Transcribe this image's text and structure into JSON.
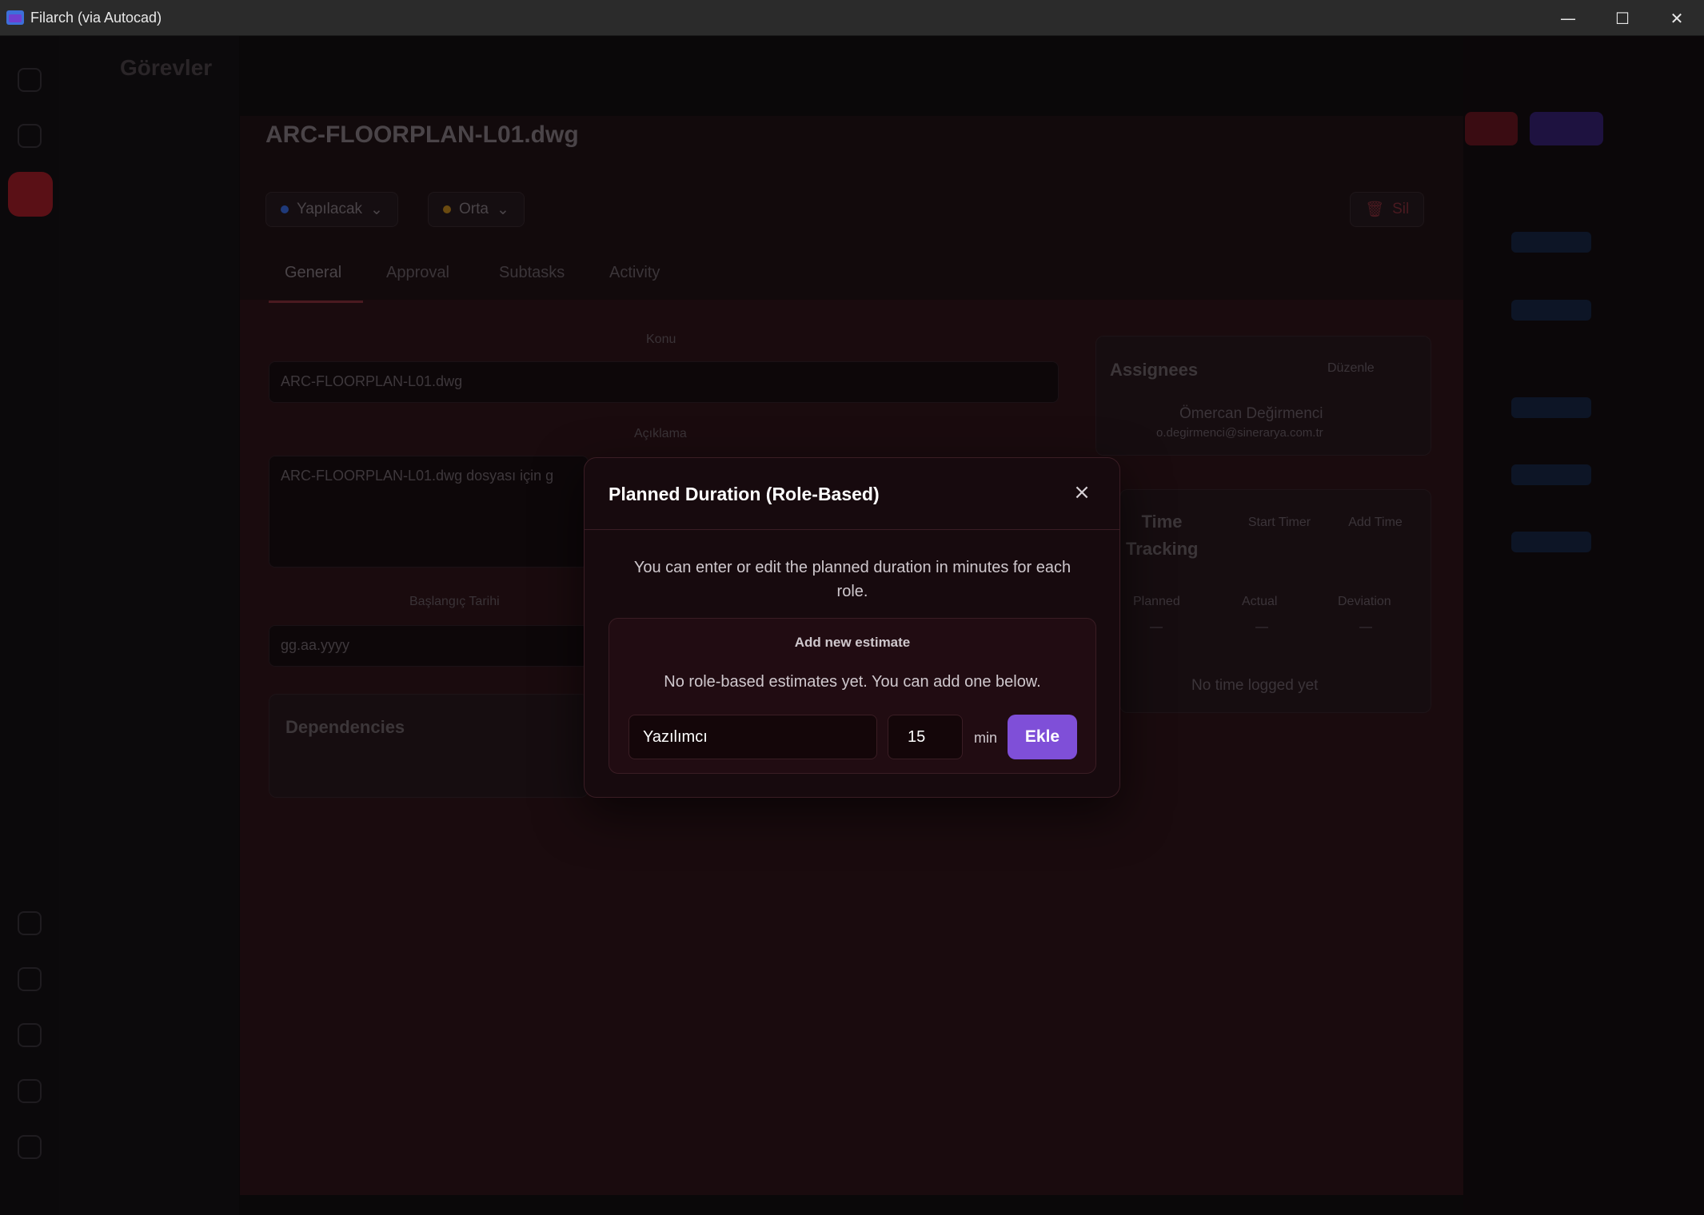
{
  "window": {
    "title": "Filarch (via Autocad)",
    "minimize": "—",
    "maximize": "☐",
    "close": "✕"
  },
  "background": {
    "header_title": "Görevler",
    "doc_title": "ARC-FLOORPLAN-L01.dwg",
    "status_pill": "Yapılacak",
    "priority_pill": "Orta",
    "delete_label": "Sil",
    "tabs": [
      "General",
      "Approval",
      "Subtasks",
      "Activity"
    ],
    "subject_label": "Konu",
    "subject_value": "ARC-FLOORPLAN-L01.dwg",
    "description_label": "Açıklama",
    "description_value": "ARC-FLOORPLAN-L01.dwg dosyası için g",
    "start_date_label": "Başlangıç Tarihi",
    "start_date_value": "gg.aa.yyyy",
    "dependencies_title": "Dependencies",
    "assignees_title": "Assignees",
    "assignees_edit": "Düzenle",
    "assignee_name": "Ömercan Değirmenci",
    "assignee_email": "o.degirmenci@sinerarya.com.tr",
    "time_tracking_title": "Time Tracking",
    "start_timer": "Start Timer",
    "add_time": "Add Time",
    "planned_label": "Planned",
    "actual_label": "Actual",
    "deviation_label": "Deviation",
    "planned_value": "—",
    "actual_value": "—",
    "deviation_value": "—",
    "no_time_logged": "No time logged yet"
  },
  "modal": {
    "title": "Planned Duration (Role-Based)",
    "close_icon": "×",
    "description": "You can enter or edit the planned duration in minutes for each role.",
    "section_heading": "Add new estimate",
    "empty_text": "No role-based estimates yet. You can add one below.",
    "role_value": "Yazılımcı",
    "minutes_value": "15",
    "unit_label": "min",
    "add_button": "Ekle"
  },
  "colors": {
    "accent": "#7f4fd8",
    "modal_bg": "#170a0e",
    "modal_border": "#3a1d24"
  }
}
